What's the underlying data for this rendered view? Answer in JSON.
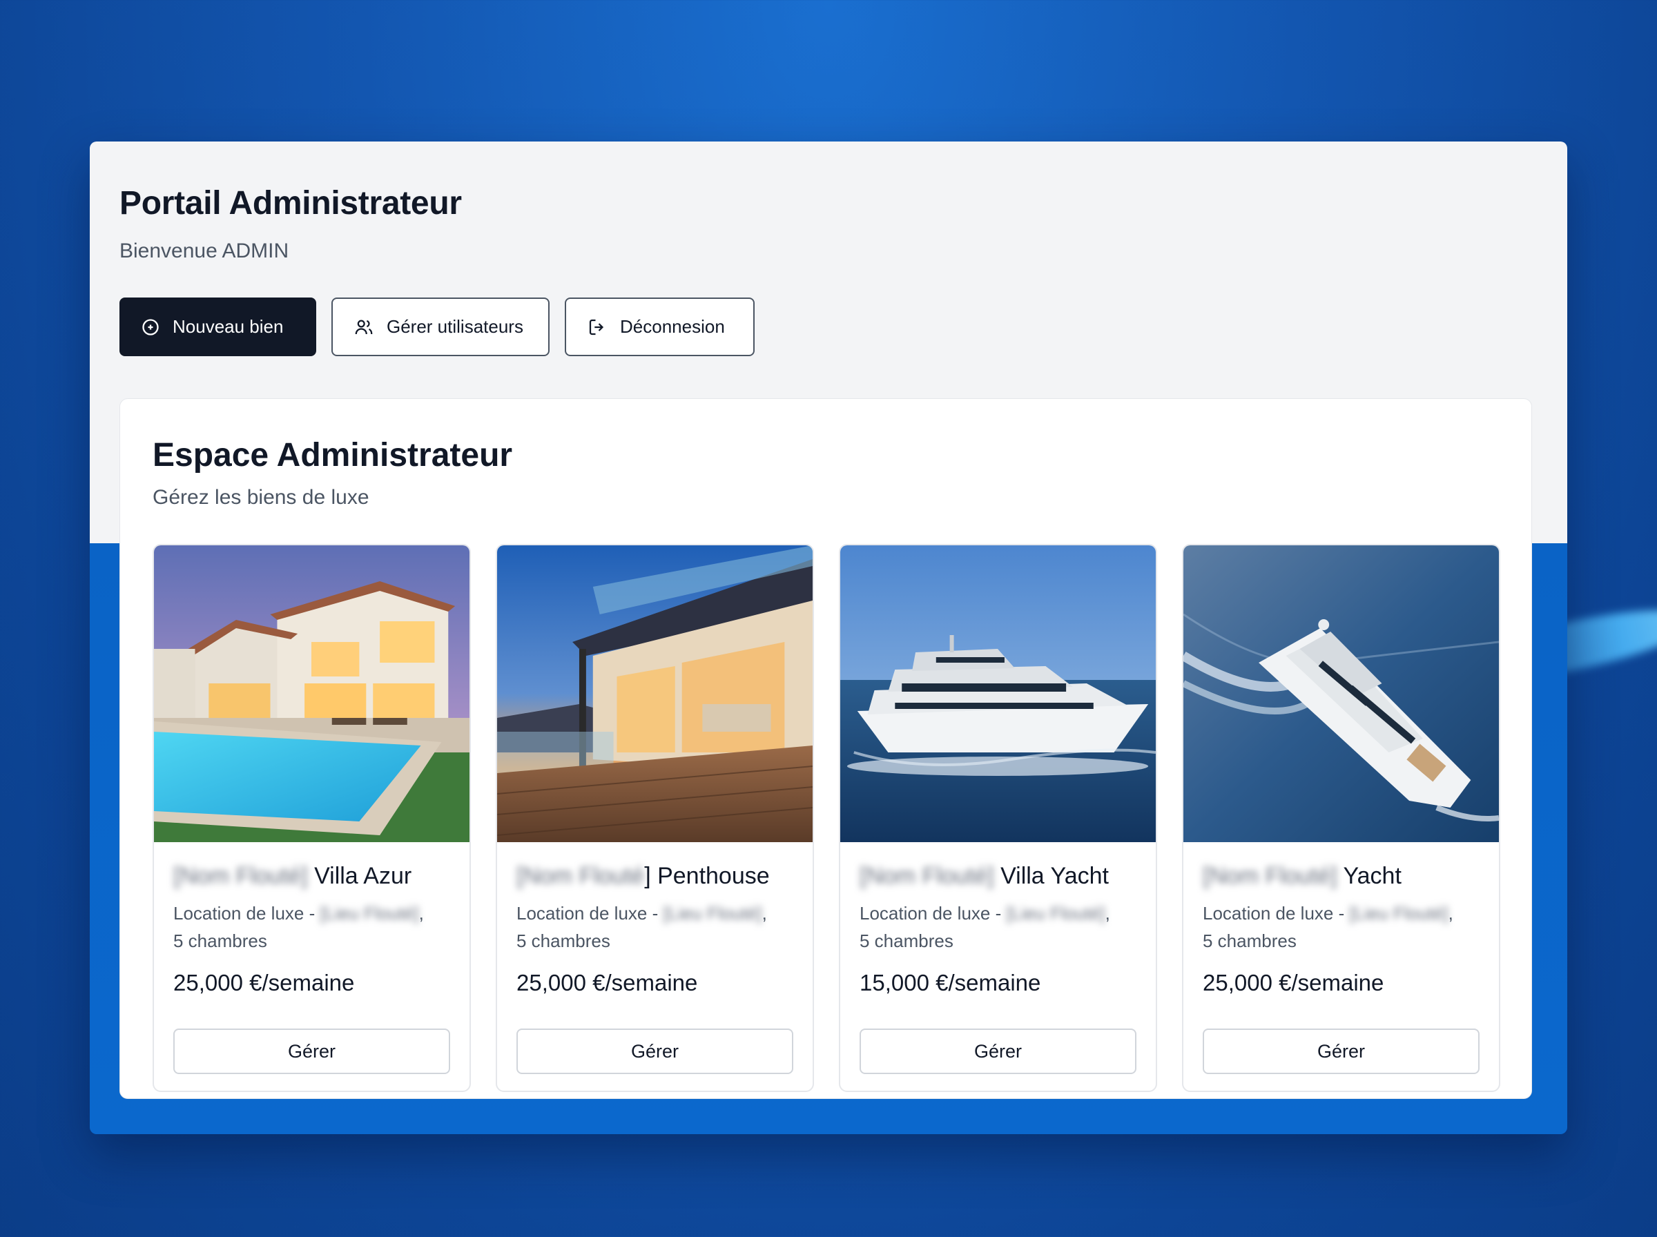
{
  "header": {
    "title": "Portail Administrateur",
    "welcome": "Bienvenue ADMIN"
  },
  "actions": {
    "new_label": "Nouveau bien",
    "users_label": "Gérer utilisateurs",
    "logout_label": "Déconnesion"
  },
  "panel": {
    "title": "Espace Administrateur",
    "subtitle": "Gérez les biens de luxe"
  },
  "properties": [
    {
      "blurred_name": "[Nom Flouté]",
      "name": "Villa Azur",
      "desc_prefix": "Location de luxe - ",
      "blurred_location": "[Lieu Flouté]",
      "desc_suffix": ",",
      "rooms": "5 chambres",
      "price": "25,000 €/semaine",
      "button": "Gérer",
      "image": "villa-pool"
    },
    {
      "blurred_name": "[Nom Flouté",
      "name": "] Penthouse",
      "desc_prefix": "Location de luxe - ",
      "blurred_location": "[Lieu Flouté]",
      "desc_suffix": ",",
      "rooms": "5 chambres",
      "price": "25,000 €/semaine",
      "button": "Gérer",
      "image": "penthouse-terrace"
    },
    {
      "blurred_name": "[Nom Flouté]",
      "name": "Villa Yacht",
      "desc_prefix": "Location de luxe - ",
      "blurred_location": "[Lieu Flouté]",
      "desc_suffix": ",",
      "rooms": "5 chambres",
      "price": "15,000 €/semaine",
      "button": "Gérer",
      "image": "yacht-side"
    },
    {
      "blurred_name": "[Nom Flouté]",
      "name": "Yacht",
      "desc_prefix": "Location de luxe - ",
      "blurred_location": "[Lieu Flouté]",
      "desc_suffix": ",",
      "rooms": "5 chambres",
      "price": "25,000 €/semaine",
      "button": "Gérer",
      "image": "yacht-aerial"
    }
  ],
  "colors": {
    "primary": "#111827",
    "background_blue": "#1356b0",
    "window_bottom_blue": "#0a63c6"
  }
}
